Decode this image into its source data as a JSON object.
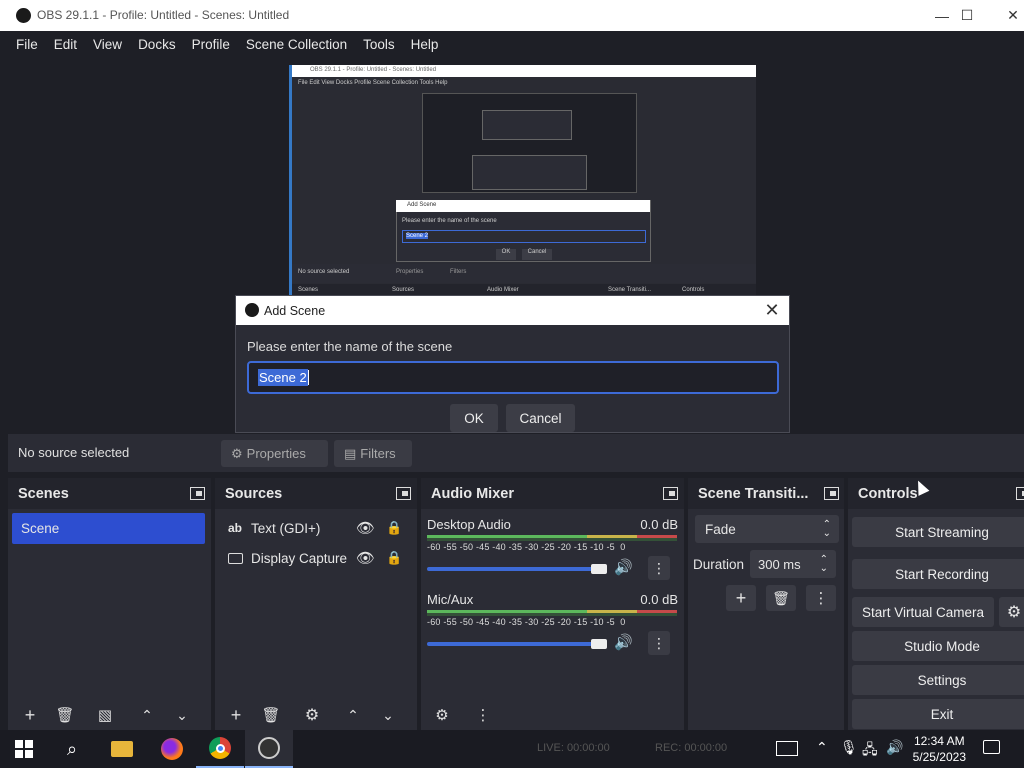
{
  "window": {
    "title": "OBS 29.1.1 - Profile: Untitled - Scenes: Untitled",
    "minimize": "—",
    "maximize": "☐",
    "close": "✕"
  },
  "menu": [
    "File",
    "Edit",
    "View",
    "Docks",
    "Profile",
    "Scene Collection",
    "Tools",
    "Help"
  ],
  "preview_mini": {
    "title": "OBS 29.1.1 - Profile: Untitled - Scenes: Untitled",
    "menu": "File  Edit  View  Docks  Profile  Scene Collection  Tools  Help",
    "dialog_title": "Add Scene",
    "dialog_prompt": "Please enter the name of the scene",
    "dialog_value": "Scene 2",
    "ok": "OK",
    "cancel": "Cancel",
    "no_source": "No source selected",
    "properties": "Properties",
    "filters": "Filters",
    "docks": [
      "Scenes",
      "Sources",
      "Audio Mixer",
      "Scene Transiti...",
      "Controls"
    ]
  },
  "dialog": {
    "title": "Add Scene",
    "prompt": "Please enter the name of the scene",
    "value": "Scene 2",
    "ok": "OK",
    "cancel": "Cancel",
    "close": "✕"
  },
  "source_toolbar": {
    "no_source": "No source selected",
    "properties": "Properties",
    "filters": "Filters"
  },
  "docks": {
    "scenes": {
      "title": "Scenes",
      "items": [
        "Scene"
      ]
    },
    "sources": {
      "title": "Sources",
      "items": [
        {
          "icon_text": "ab",
          "label": "Text (GDI+)"
        },
        {
          "icon_text": "",
          "label": "Display Capture"
        }
      ]
    },
    "audio": {
      "title": "Audio Mixer",
      "channels": [
        {
          "name": "Desktop Audio",
          "level": "0.0 dB"
        },
        {
          "name": "Mic/Aux",
          "level": "0.0 dB"
        }
      ],
      "ticks": [
        "-60",
        "-55",
        "-50",
        "-45",
        "-40",
        "-35",
        "-30",
        "-25",
        "-20",
        "-15",
        "-10",
        "-5",
        "0"
      ]
    },
    "transitions": {
      "title": "Scene Transiti...",
      "selected": "Fade",
      "duration_label": "Duration",
      "duration_value": "300 ms"
    },
    "controls": {
      "title": "Controls",
      "buttons": [
        "Start Streaming",
        "Start Recording",
        "Start Virtual Camera",
        "Studio Mode",
        "Settings",
        "Exit"
      ]
    }
  },
  "status": {
    "live": "LIVE: 00:00:00",
    "rec": "REC: 00:00:00"
  },
  "clock": {
    "time": "12:34 AM",
    "date": "5/25/2023"
  },
  "colors": {
    "accent": "#2d4ed0",
    "bg": "#1e1f26",
    "panel": "#2b2c35",
    "meter_green": "#5cb85c",
    "meter_yellow": "#c8b44a",
    "meter_red": "#c64a4a"
  }
}
